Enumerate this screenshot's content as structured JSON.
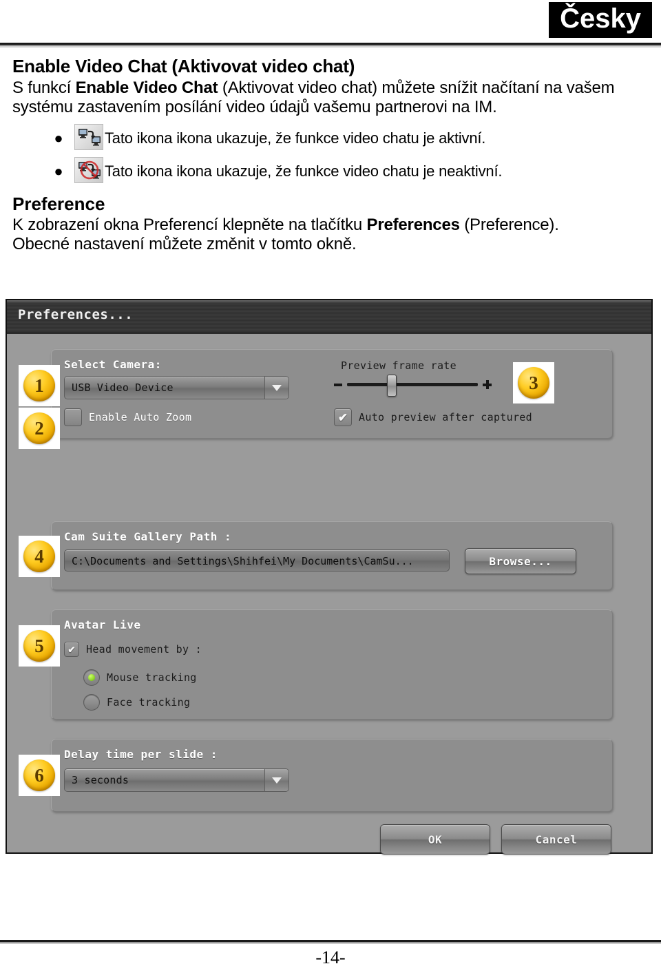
{
  "page": {
    "language_badge": "Česky",
    "page_number": "-14-"
  },
  "section_video_chat": {
    "heading": "Enable Video Chat (Aktivovat video chat)",
    "paragraph_prefix": "S funkcí ",
    "paragraph_bold": "Enable Video Chat",
    "paragraph_rest": " (Aktivovat video chat) můžete snížit načítaní na vašem systému zastavením posílání video údajů vašemu partnerovi na IM.",
    "bullets": [
      {
        "icon": "video-chat-active-icon",
        "text": "Tato ikona ikona ukazuje, že funkce video chatu je aktivní."
      },
      {
        "icon": "video-chat-inactive-icon",
        "text": "Tato ikona ikona ukazuje, že funkce video chatu je neaktivní."
      }
    ]
  },
  "section_preference": {
    "heading": "Preference",
    "line1_prefix": "K zobrazení okna Preferencí klepněte na tlačítku ",
    "line1_bold": "Preferences",
    "line1_rest": " (Preference).",
    "line2": "Obecné nastavení můžete změnit v tomto okně."
  },
  "dialog": {
    "title": "Preferences...",
    "badges": {
      "one": "1",
      "two": "2",
      "three": "3",
      "four": "4",
      "five": "5",
      "six": "6"
    },
    "camera_group": {
      "label": "Select Camera:",
      "selected_camera": "USB Video Device",
      "auto_zoom_label": "Enable Auto Zoom",
      "auto_zoom_checked": false,
      "frame_rate_label": "Preview frame rate",
      "frame_rate_minus": "−",
      "frame_rate_plus": "+",
      "auto_preview_label": "Auto preview after captured",
      "auto_preview_checked": true
    },
    "gallery_group": {
      "label": "Cam Suite Gallery Path :",
      "path_value": "C:\\Documents and Settings\\Shihfei\\My Documents\\CamSu...",
      "browse_label": "Browse..."
    },
    "avatar_group": {
      "label": "Avatar Live",
      "head_movement_label": "Head movement by :",
      "head_movement_checked": true,
      "radio_mouse_label": "Mouse tracking",
      "radio_face_label": "Face tracking",
      "selected_radio": "Mouse tracking"
    },
    "slide_group": {
      "label": "Delay time per slide :",
      "selected_delay": "3 seconds"
    },
    "buttons": {
      "ok": "OK",
      "cancel": "Cancel"
    }
  },
  "colors": {
    "badge_gold": "#ffcc22",
    "dialog_bg": "#9b9b9b",
    "panel_bg": "#8e8e8e",
    "titlebar": "#333333",
    "radio_on": "#88dd22"
  }
}
